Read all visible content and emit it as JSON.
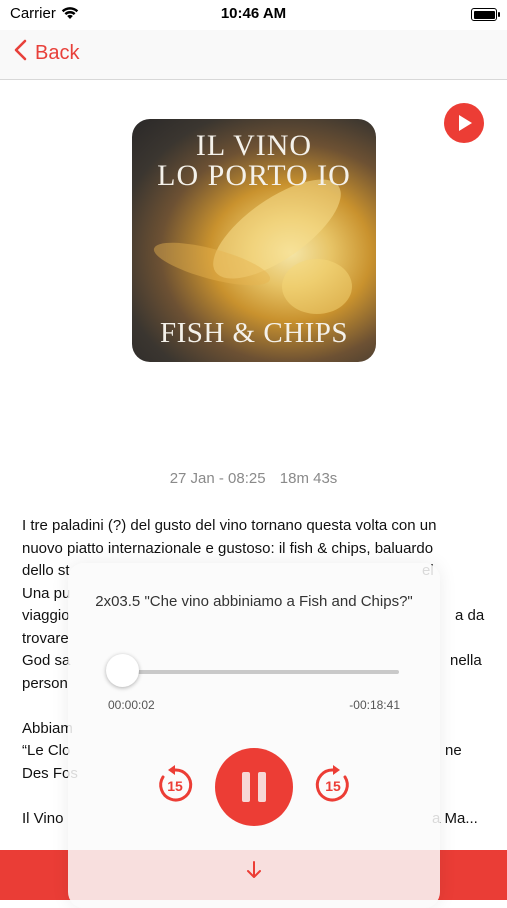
{
  "status_bar": {
    "carrier": "Carrier",
    "time": "10:46 AM"
  },
  "nav": {
    "back_label": "Back"
  },
  "artwork": {
    "line1": "IL VINO",
    "line2": "LO PORTO IO",
    "line3": "FISH & CHIPS"
  },
  "episode": {
    "date": "27 Jan - 08:25",
    "duration": "18m 43s"
  },
  "description": {
    "lines": [
      "I tre paladini (?) del gusto del vino tornano questa volta con un",
      "nuovo piatto internazionale e gustoso: il fish & chips, baluardo",
      "dello st",
      "Una pu",
      "viaggio",
      "trovare",
      "God sa",
      "person",
      "",
      "Abbiam",
      "“Le Clo",
      "Des Fos",
      "",
      "Il Vino"
    ],
    "fragments": {
      "line3_right": "el",
      "line4_right": "a da",
      "line6_right": "nella",
      "line9_right": "ne",
      "line13_right": "a Ma..."
    }
  },
  "player": {
    "title": "2x03.5 \"Che vino abbiniamo a Fish and Chips?\"",
    "elapsed": "00:00:02",
    "remaining": "-00:18:41",
    "progress": 0.002,
    "skip_back_seconds": "15",
    "skip_forward_seconds": "15"
  },
  "colors": {
    "accent": "#ec3d35"
  }
}
